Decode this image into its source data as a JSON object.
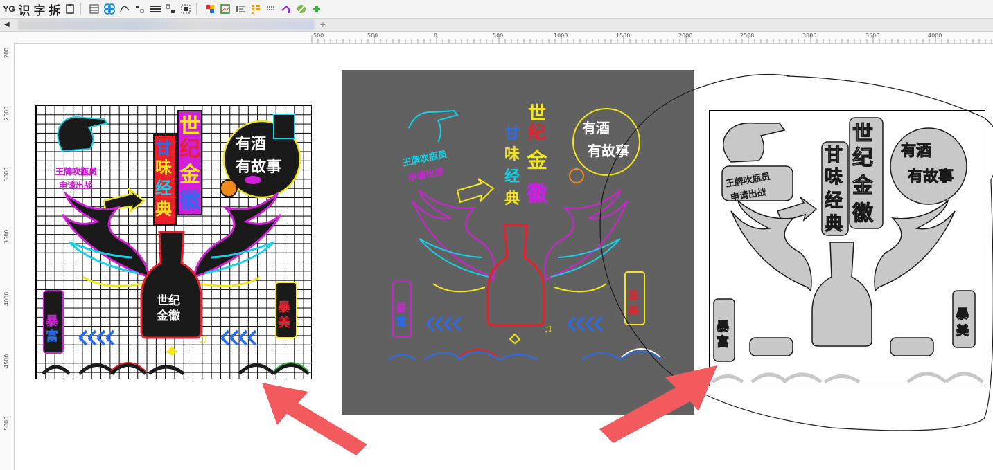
{
  "toolbar": {
    "items": [
      "YG",
      "识",
      "字",
      "拆"
    ]
  },
  "tabs": {
    "add_label": "+"
  },
  "ruler": {
    "h_labels": [
      "500",
      "500",
      "0",
      "500",
      "1000",
      "1500",
      "2000",
      "2500",
      "3000",
      "3500",
      "4000"
    ],
    "v_labels": [
      "200",
      "2500",
      "3000",
      "3500",
      "4000",
      "4500",
      "5000"
    ]
  },
  "artwork": {
    "tower_title": [
      "世",
      "纪",
      "金",
      "徽"
    ],
    "tower_sub": [
      "甘",
      "味",
      "经",
      "典"
    ],
    "circle_line1": "有酒",
    "circle_line2": "有故事",
    "badge_line1": "王牌吹瓶员",
    "badge_line2": "申请出战",
    "bottle_line1": "世纪",
    "bottle_line2": "金徽",
    "left_tag": [
      "暴",
      "富"
    ],
    "right_tag": [
      "暴",
      "美"
    ]
  },
  "colors": {
    "neon_cyan": "#18d0e8",
    "neon_magenta": "#d020d8",
    "neon_yellow": "#f4e61c",
    "neon_red": "#e8202c",
    "neon_blue": "#2a6cf0",
    "arrow_red": "#f25a5e",
    "dark_bg": "#616161",
    "cut_gray": "#c8c8c8"
  }
}
